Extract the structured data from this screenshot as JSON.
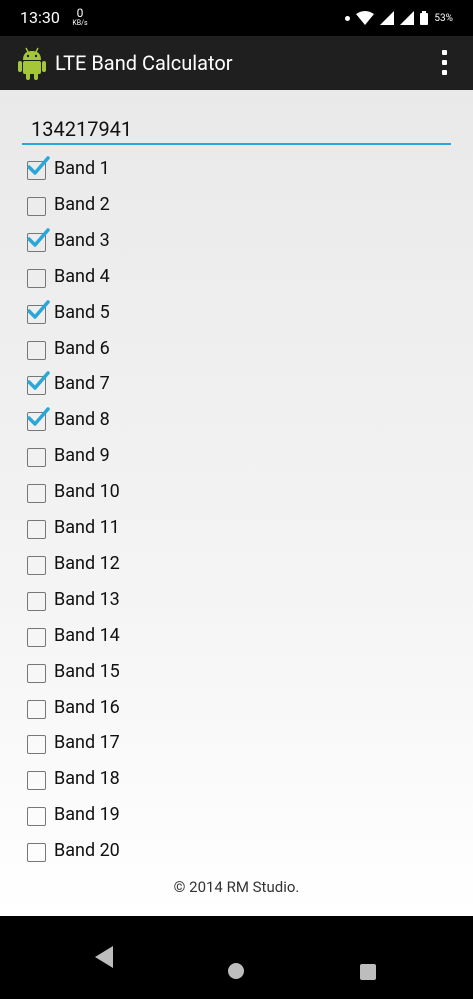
{
  "status_bar": {
    "time": "13:30",
    "net_speed_value": "0",
    "net_speed_unit": "KB/s",
    "battery": "53%"
  },
  "app_bar": {
    "title": "LTE Band Calculator"
  },
  "bitmask_value": "134217941",
  "bands": [
    {
      "label": "Band 1",
      "checked": true
    },
    {
      "label": "Band 2",
      "checked": false
    },
    {
      "label": "Band 3",
      "checked": true
    },
    {
      "label": "Band 4",
      "checked": false
    },
    {
      "label": "Band 5",
      "checked": true
    },
    {
      "label": "Band 6",
      "checked": false
    },
    {
      "label": "Band 7",
      "checked": true
    },
    {
      "label": "Band 8",
      "checked": true
    },
    {
      "label": "Band 9",
      "checked": false
    },
    {
      "label": "Band 10",
      "checked": false
    },
    {
      "label": "Band 11",
      "checked": false
    },
    {
      "label": "Band 12",
      "checked": false
    },
    {
      "label": "Band 13",
      "checked": false
    },
    {
      "label": "Band 14",
      "checked": false
    },
    {
      "label": "Band 15",
      "checked": false
    },
    {
      "label": "Band 16",
      "checked": false
    },
    {
      "label": "Band 17",
      "checked": false
    },
    {
      "label": "Band 18",
      "checked": false
    },
    {
      "label": "Band 19",
      "checked": false
    },
    {
      "label": "Band 20",
      "checked": false
    }
  ],
  "footer": "© 2014 RM Studio.",
  "colors": {
    "accent": "#29a8d8",
    "app_bar": "#1f1f1f"
  }
}
